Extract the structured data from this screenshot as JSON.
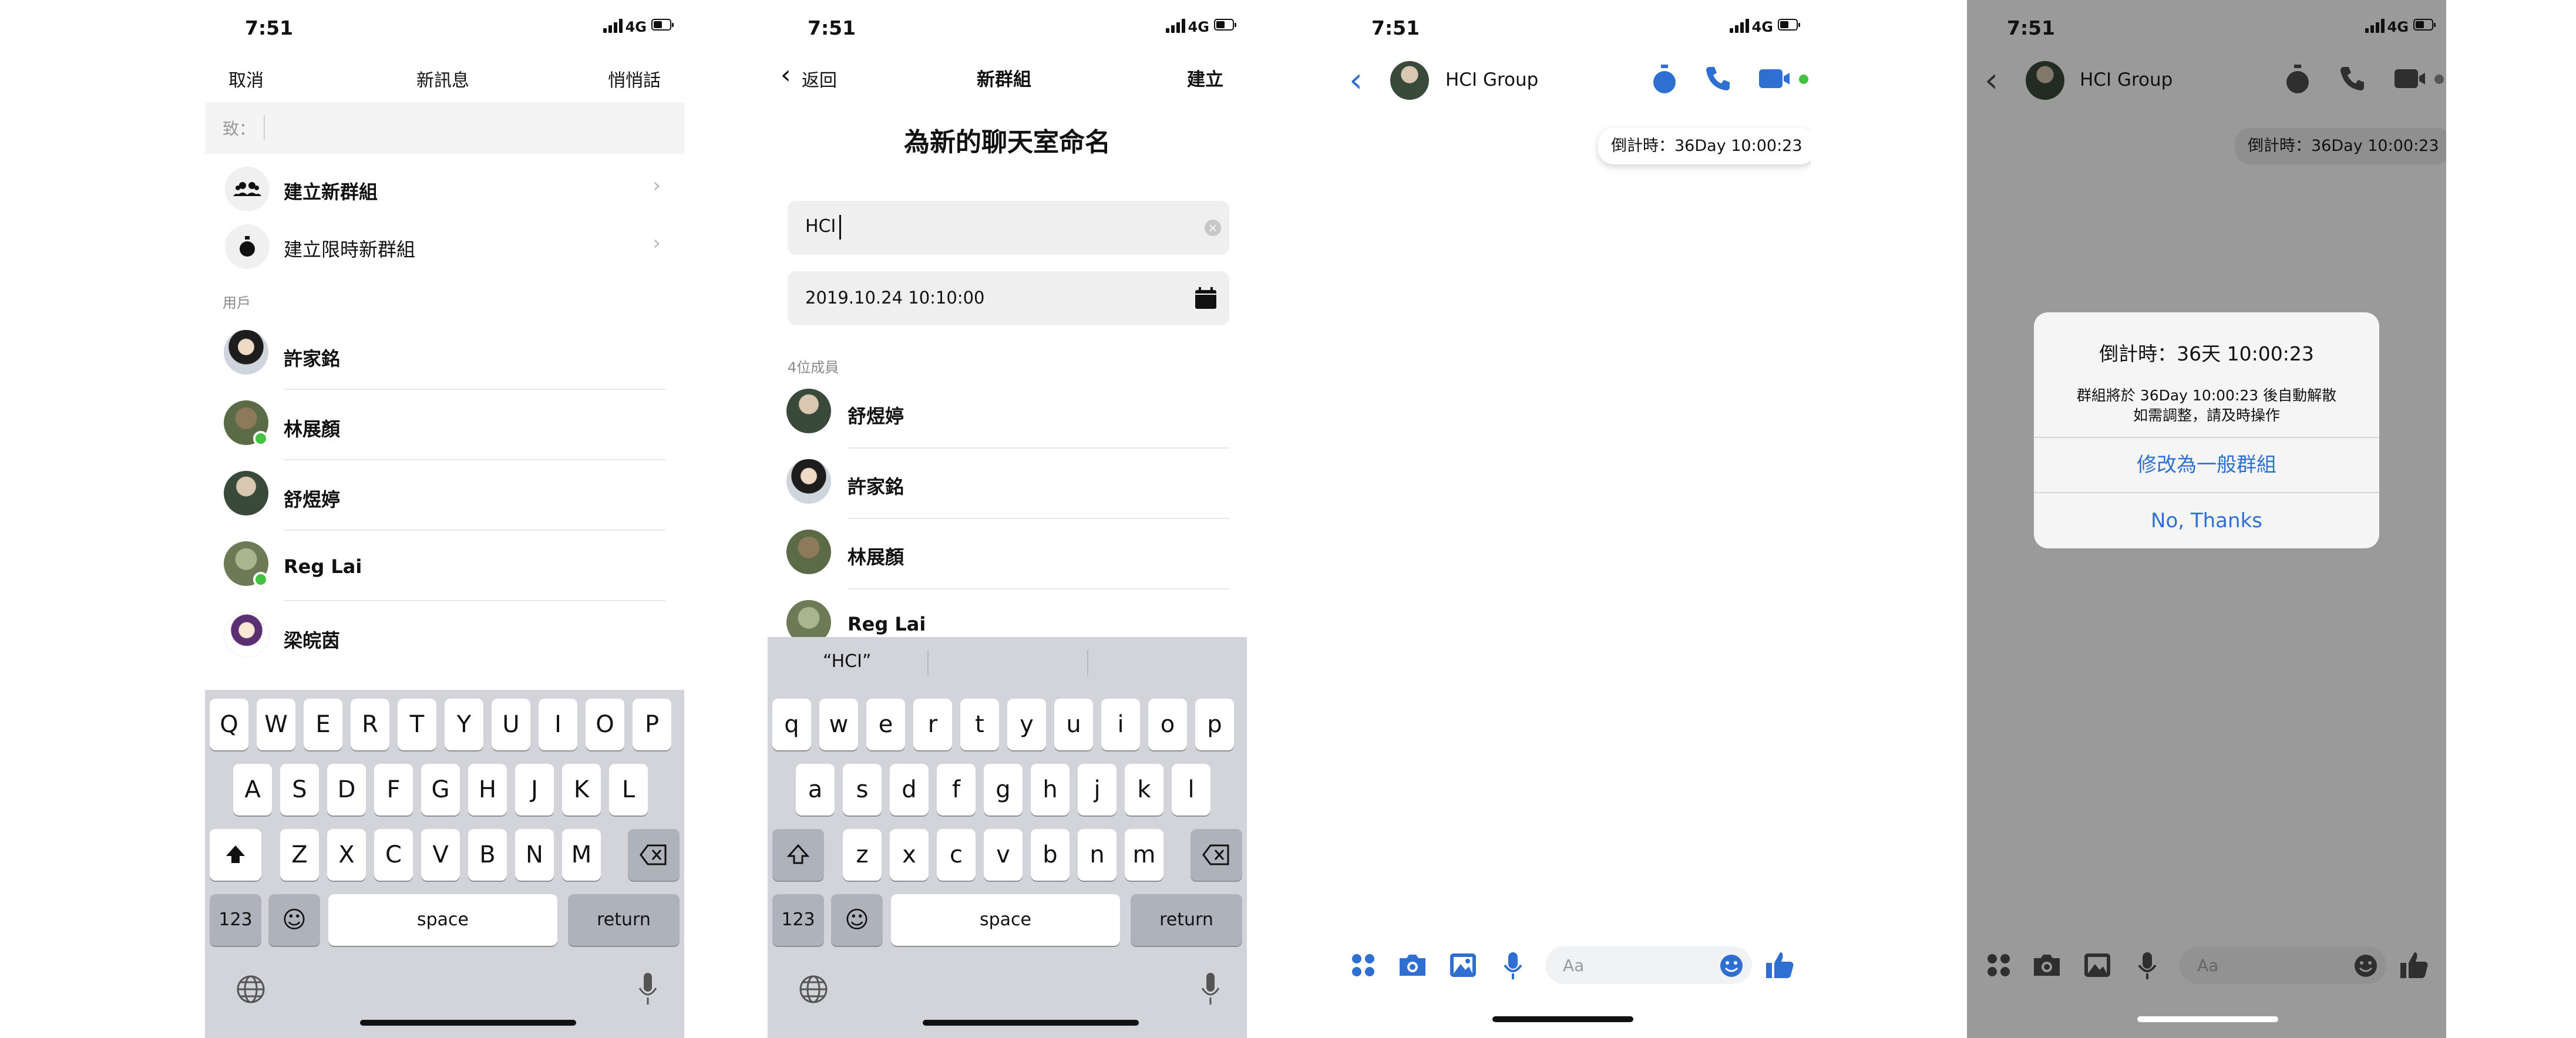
{
  "status": {
    "time": "7:51",
    "network": "4G"
  },
  "screen1": {
    "nav": {
      "cancel": "取消",
      "title": "新訊息",
      "secret": "悄悄話"
    },
    "to_label": "致：",
    "options": [
      "建立新群組",
      "建立限時新群組"
    ],
    "section": "用戶",
    "users": [
      "許家銘",
      "林展顏",
      "舒煜婷",
      "Reg Lai",
      "梁皖茵"
    ]
  },
  "screen2": {
    "nav": {
      "back": "返回",
      "title": "新群組",
      "create": "建立"
    },
    "heading": "為新的聊天室命名",
    "name_value": "HCI",
    "date_value": "2019.10.24 10:10:00",
    "member_count": "4位成員",
    "members": [
      "舒煜婷",
      "許家銘",
      "林展顏",
      "Reg Lai"
    ],
    "suggestion": "“HCI”"
  },
  "keyboard": {
    "upper": {
      "row1": [
        "Q",
        "W",
        "E",
        "R",
        "T",
        "Y",
        "U",
        "I",
        "O",
        "P"
      ],
      "row2": [
        "A",
        "S",
        "D",
        "F",
        "G",
        "H",
        "J",
        "K",
        "L"
      ],
      "row3": [
        "Z",
        "X",
        "C",
        "V",
        "B",
        "N",
        "M"
      ]
    },
    "lower": {
      "row1": [
        "q",
        "w",
        "e",
        "r",
        "t",
        "y",
        "u",
        "i",
        "o",
        "p"
      ],
      "row2": [
        "a",
        "s",
        "d",
        "f",
        "g",
        "h",
        "j",
        "k",
        "l"
      ],
      "row3": [
        "z",
        "x",
        "c",
        "v",
        "b",
        "n",
        "m"
      ]
    },
    "n123": "123",
    "space": "space",
    "return": "return"
  },
  "chat": {
    "title": "HCI Group",
    "countdown": "倒計時：36Day 10:00:23",
    "input_placeholder": "Aa"
  },
  "dialog": {
    "title": "倒計時：36天 10:00:23",
    "message_line1": "群組將於 36Day 10:00:23 後自動解散",
    "message_line2": "如需調整，請及時操作",
    "action1": "修改為一般群組",
    "action2": "No, Thanks"
  },
  "colors": {
    "accent": "#2f6fd1",
    "online": "#43c241",
    "overlay": "#9a9a9a"
  },
  "icons": [
    "signal-icon",
    "battery-icon",
    "chevron-left-icon",
    "chevron-right-icon",
    "group-icon",
    "stopwatch-icon",
    "phone-icon",
    "video-icon",
    "calendar-icon",
    "clear-icon",
    "shift-icon",
    "delete-icon",
    "emoji-icon",
    "globe-icon",
    "mic-icon",
    "apps-icon",
    "camera-icon",
    "photo-icon",
    "like-icon"
  ]
}
